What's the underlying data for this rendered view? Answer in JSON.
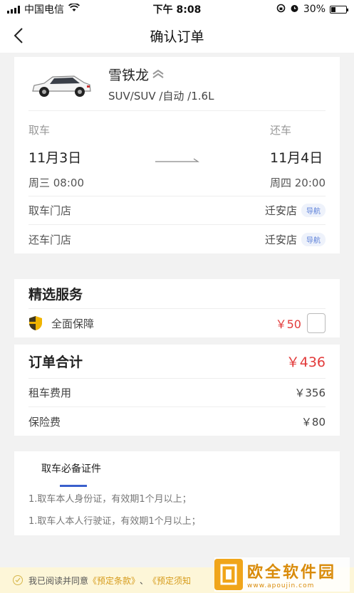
{
  "status_bar": {
    "carrier": "中国电信",
    "time": "下午 8:08",
    "battery": "30%",
    "battery_level": 0.3
  },
  "nav": {
    "title": "确认订单"
  },
  "car": {
    "name": "雪铁龙",
    "spec": "SUV/SUV /自动 /1.6L"
  },
  "trip": {
    "pickup_label": "取车",
    "pickup_date": "11月3日",
    "pickup_time": "周三 08:00",
    "return_label": "还车",
    "return_date": "11月4日",
    "return_time": "周四 20:00"
  },
  "stores": [
    {
      "label": "取车门店",
      "name": "迁安店",
      "nav": "导航"
    },
    {
      "label": "还车门店",
      "name": "迁安店",
      "nav": "导航"
    }
  ],
  "services": {
    "title": "精选服务",
    "items": [
      {
        "label": "全面保障",
        "price": "￥50"
      }
    ]
  },
  "order_total": {
    "title": "订单合计",
    "total": "￥436",
    "fees": [
      {
        "label": "租车费用",
        "amount": "￥356"
      },
      {
        "label": "保险费",
        "amount": "￥80"
      }
    ]
  },
  "docs": {
    "tab": "取车必备证件",
    "lines": [
      "1.取车本人身份证，有效期1个月以上；",
      "1.取车人本人行驶证，有效期1个月以上；"
    ]
  },
  "agreement": {
    "text": "我已阅读并同意",
    "link1": "《预定条款》",
    "sep": "、",
    "link2": "《预定须知"
  },
  "watermark": {
    "name": "欧全软件园",
    "url": "www.apoujin.com"
  },
  "colors": {
    "accent_red": "#e23a3a",
    "link_blue": "#3a5fcc",
    "agree_bg": "#fdf6d8",
    "shield": "#f0b400"
  }
}
